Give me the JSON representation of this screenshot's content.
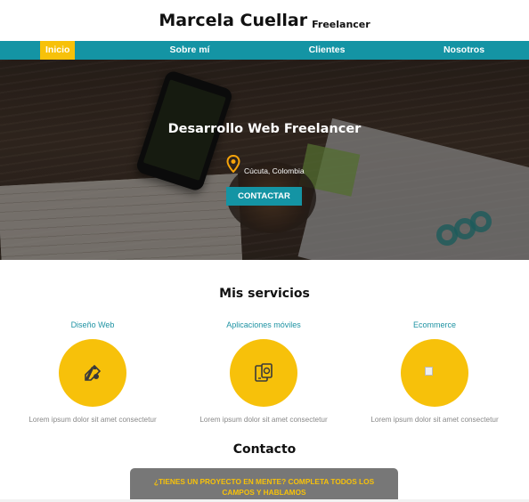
{
  "header": {
    "name": "Marcela Cuellar",
    "tagline": "Freelancer"
  },
  "nav": {
    "items": [
      "Inicio",
      "Sobre mí",
      "Clientes",
      "Nosotros"
    ],
    "active": "Inicio"
  },
  "hero": {
    "title": "Desarrollo Web Freelancer",
    "location": "Cúcuta, Colombia",
    "cta": "CONTACTAR",
    "icons": [
      "location-pin-icon"
    ]
  },
  "services": {
    "title": "Mis servicios",
    "items": [
      {
        "title": "Diseño Web",
        "description": "Lorem ipsum dolor sit amet consectetur",
        "icon": "design-tools-icon"
      },
      {
        "title": "Aplicaciones móviles",
        "description": "Lorem ipsum dolor sit amet consectetur",
        "icon": "mobile-app-icon"
      },
      {
        "title": "Ecommerce",
        "description": "Lorem ipsum dolor sit amet consectetur",
        "icon": "broken-image-icon"
      }
    ]
  },
  "contact": {
    "title": "Contacto",
    "banner": "¿TIENES UN PROYECTO EN MENTE? COMPLETA TODOS LOS CAMPOS Y HABLAMOS"
  },
  "colors": {
    "teal": "#1494a4",
    "yellow": "#f7c10a",
    "banner_gray": "#777777"
  }
}
